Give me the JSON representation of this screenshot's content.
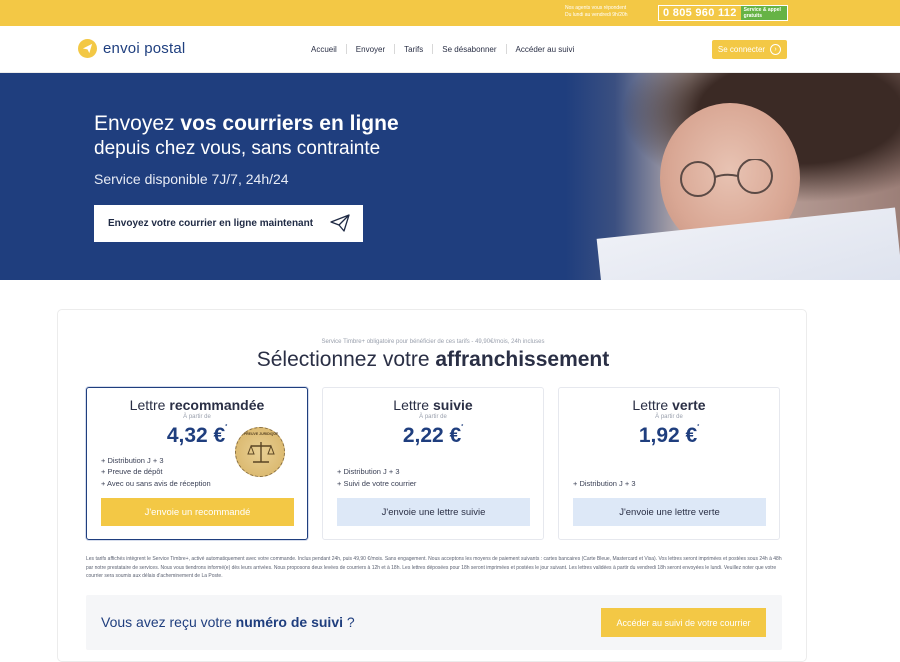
{
  "topbar": {
    "hint_line1": "Nos agents vous répondent",
    "hint_line2": "Du lundi au vendredi 9h/20h",
    "phone": "0 805 960 112",
    "phone_tag_line1": "Service & appel",
    "phone_tag_line2": "gratuits"
  },
  "header": {
    "logo_text": "envoi postal",
    "nav": [
      "Accueil",
      "Envoyer",
      "Tarifs",
      "Se désabonner",
      "Accéder au suivi"
    ],
    "login_label": "Se connecter"
  },
  "hero": {
    "line1_normal": "Envoyez ",
    "line1_bold": "vos courriers en ligne",
    "line2": "depuis chez vous, sans contrainte",
    "line3": "Service disponible 7J/7, 24h/24",
    "cta_label": "Envoyez votre courrier en ligne maintenant"
  },
  "pricing": {
    "notice": "Service Timbre+ obligatoire pour bénéficier de ces tarifs - 49,90€/mois, 24h incluses",
    "title_normal": "Sélectionnez votre ",
    "title_bold": "affranchissement",
    "cards": [
      {
        "title_normal": "Lettre ",
        "title_bold": "recommandée",
        "from": "À partir de",
        "price": "4,32 €",
        "price_mark": "*",
        "features": [
          "+ Distribution J + 3",
          "+ Preuve de dépôt",
          "+ Avec ou sans avis de réception"
        ],
        "button": "J'envoie un recommandé",
        "stamp_text": "PREUVE JURIDIQUE"
      },
      {
        "title_normal": "Lettre ",
        "title_bold": "suivie",
        "from": "À partir de",
        "price": "2,22 €",
        "price_mark": "*",
        "features": [
          "+ Distribution J + 3",
          "+ Suivi de votre courrier"
        ],
        "button": "J'envoie une lettre suivie"
      },
      {
        "title_normal": "Lettre ",
        "title_bold": "verte",
        "from": "À partir de",
        "price": "1,92 €",
        "price_mark": "*",
        "features": [
          "+ Distribution J + 3"
        ],
        "button": "J'envoie une lettre verte"
      }
    ],
    "legal": "Les tarifs affichés intègrent le Service Timbre+, activé automatiquement avec votre commande. Inclus pendant 24h, puis 49,90 €/mois. Sans engagement. Nous acceptons les moyens de paiement suivants : cartes bancaires (Carte Bleue, Mastercard et Visa). Vos lettres seront imprimées et postées sous 24h à 48h par notre prestataire de services. Nous vous tiendrons informé(e) dès leurs arrivées. Nous proposons deux levées de courriers à 12h et à 18h. Les lettres déposées pour 18h seront imprimées et postées le jour suivant. Les lettres validées à partir du vendredi 18h seront envoyées le lundi. Veuillez noter que votre courrier sera soumis aux délais d'acheminement de La Poste.",
    "track_text_normal": "Vous avez reçu votre ",
    "track_text_bold": "numéro de suivi",
    "track_text_end": " ?",
    "track_button": "Accéder au suivi de votre courrier"
  },
  "colors": {
    "accent_yellow": "#f3c845",
    "brand_blue": "#1f3e7e",
    "light_blue_button": "#dde8f7",
    "phone_tag_green": "#66b345"
  }
}
